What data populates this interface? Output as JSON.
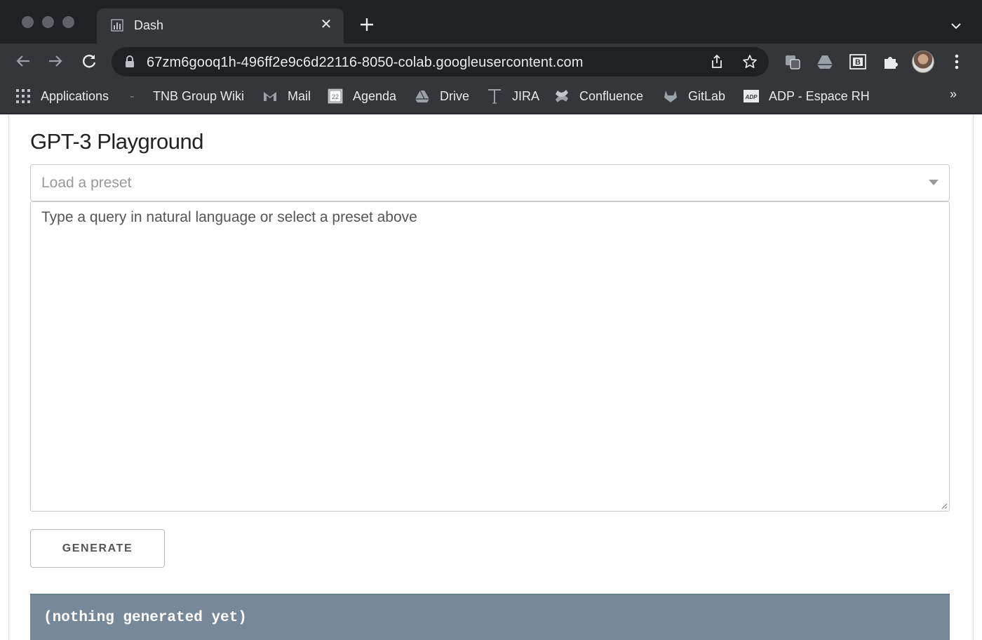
{
  "browser": {
    "tab": {
      "title": "Dash",
      "favicon": "dash-chart-icon"
    },
    "url": "67zm6gooq1h-496ff2e9c6d22116-8050-colab.googleusercontent.com",
    "bookmarks": [
      {
        "label": "Applications",
        "icon": "apps-grid-icon"
      },
      {
        "label": "TNB Group Wiki",
        "icon": "wiki-icon"
      },
      {
        "label": "Mail",
        "icon": "gmail-icon"
      },
      {
        "label": "Agenda",
        "icon": "calendar-icon",
        "day": "22"
      },
      {
        "label": "Drive",
        "icon": "drive-icon"
      },
      {
        "label": "JIRA",
        "icon": "jira-icon"
      },
      {
        "label": "Confluence",
        "icon": "confluence-icon"
      },
      {
        "label": "GitLab",
        "icon": "gitlab-icon"
      },
      {
        "label": "ADP - Espace RH",
        "icon": "adp-icon",
        "logo_text": "ADP"
      }
    ],
    "bookmarks_more": "»"
  },
  "page": {
    "title": "GPT-3 Playground",
    "preset_placeholder": "Load a preset",
    "query_placeholder": "Type a query in natural language or select a preset above",
    "generate_label": "GENERATE",
    "output_text": "(nothing generated yet)"
  },
  "colors": {
    "output_background": "#778899",
    "chrome_dark": "#202124",
    "chrome_toolbar": "#35363a"
  }
}
